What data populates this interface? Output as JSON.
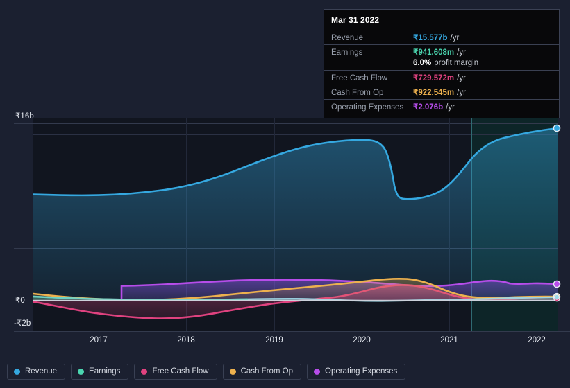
{
  "chart_data": {
    "type": "area",
    "title": "",
    "xlabel": "",
    "ylabel": "",
    "currency_symbol": "₹",
    "ylim": [
      -2,
      16
    ],
    "y_ticks": [
      {
        "label": "₹16b",
        "value": 16
      },
      {
        "label": "₹0",
        "value": 0
      },
      {
        "label": "-₹2b",
        "value": -2
      }
    ],
    "gridlines": [
      16,
      11,
      6,
      0,
      -2
    ],
    "x_ticks": [
      "2017",
      "2018",
      "2019",
      "2020",
      "2021",
      "2022"
    ],
    "x_range": [
      "2016-06",
      "2022-03"
    ],
    "grid": true,
    "legend_position": "bottom-left",
    "forecast_divider_x_label": "2021-03",
    "series": [
      {
        "name": "Revenue",
        "color": "#35a8e0",
        "unit": "b",
        "x": [
          "2016-06",
          "2016-12",
          "2017-06",
          "2017-12",
          "2018-06",
          "2018-12",
          "2019-06",
          "2019-12",
          "2020-03",
          "2020-06",
          "2020-09",
          "2020-12",
          "2021-03",
          "2021-06",
          "2021-09",
          "2021-12",
          "2022-03"
        ],
        "values": [
          9.6,
          9.5,
          9.45,
          9.6,
          10.4,
          11.6,
          12.7,
          13.2,
          13.2,
          12.6,
          9.3,
          9.25,
          10.1,
          12.7,
          13.9,
          14.3,
          15.577
        ]
      },
      {
        "name": "Earnings",
        "color": "#4bd6b0",
        "unit": "m",
        "x": [
          "2016-06",
          "2016-12",
          "2017-06",
          "2017-12",
          "2018-06",
          "2018-12",
          "2019-06",
          "2019-12",
          "2020-03",
          "2020-06",
          "2020-09",
          "2020-12",
          "2021-03",
          "2021-06",
          "2021-09",
          "2021-12",
          "2022-03"
        ],
        "values": [
          0.33,
          0.22,
          0.13,
          0.1,
          0.12,
          0.18,
          0.25,
          0.3,
          0.22,
          0.08,
          0.05,
          0.06,
          0.3,
          0.38,
          0.52,
          0.72,
          0.941608
        ]
      },
      {
        "name": "Free Cash Flow",
        "color": "#e0427f",
        "unit": "m",
        "x": [
          "2016-06",
          "2016-12",
          "2017-06",
          "2017-12",
          "2018-06",
          "2018-12",
          "2019-06",
          "2019-12",
          "2020-03",
          "2020-06",
          "2020-09",
          "2020-12",
          "2021-03",
          "2021-06",
          "2021-09",
          "2021-12",
          "2022-03"
        ],
        "values": [
          -0.15,
          -0.7,
          -1.1,
          -1.25,
          -1.0,
          -0.6,
          -0.38,
          -0.22,
          0.3,
          1.05,
          1.45,
          1.15,
          0.3,
          0.05,
          0.2,
          0.5,
          0.729572
        ]
      },
      {
        "name": "Cash From Op",
        "color": "#edb14e",
        "unit": "m",
        "x": [
          "2016-06",
          "2016-12",
          "2017-06",
          "2017-12",
          "2018-06",
          "2018-12",
          "2019-06",
          "2019-12",
          "2020-03",
          "2020-06",
          "2020-09",
          "2020-12",
          "2021-03",
          "2021-06",
          "2021-09",
          "2021-12",
          "2022-03"
        ],
        "values": [
          0.55,
          0.25,
          -0.05,
          -0.12,
          0.05,
          0.45,
          0.8,
          1.0,
          1.25,
          1.65,
          1.8,
          1.5,
          0.62,
          0.42,
          0.48,
          0.72,
          0.922545
        ]
      },
      {
        "name": "Operating Expenses",
        "color": "#b74dea",
        "unit": "b",
        "x": [
          "2017-03",
          "2017-06",
          "2017-12",
          "2018-06",
          "2018-12",
          "2019-06",
          "2019-12",
          "2020-06",
          "2020-12",
          "2021-03",
          "2021-06",
          "2021-09",
          "2021-12",
          "2022-03"
        ],
        "values": [
          1.3,
          1.32,
          1.42,
          1.55,
          1.62,
          1.65,
          1.62,
          1.42,
          1.35,
          1.62,
          1.95,
          2.05,
          1.98,
          2.076
        ]
      }
    ]
  },
  "tooltip": {
    "date": "Mar 31 2022",
    "unit_suffix": "/yr",
    "rows": [
      {
        "label": "Revenue",
        "value": "₹15.577b",
        "unit": "/yr",
        "color": "#35a8e0"
      },
      {
        "label": "Earnings",
        "value": "₹941.608m",
        "unit": "/yr",
        "color": "#4bd6b0"
      },
      {
        "label": "Free Cash Flow",
        "value": "₹729.572m",
        "unit": "/yr",
        "color": "#e0427f"
      },
      {
        "label": "Cash From Op",
        "value": "₹922.545m",
        "unit": "/yr",
        "color": "#edb14e"
      },
      {
        "label": "Operating Expenses",
        "value": "₹2.076b",
        "unit": "/yr",
        "color": "#b74dea"
      }
    ],
    "profit_margin_value": "6.0%",
    "profit_margin_label": "profit margin"
  },
  "legend": {
    "items": [
      {
        "label": "Revenue",
        "color": "#35a8e0"
      },
      {
        "label": "Earnings",
        "color": "#4bd6b0"
      },
      {
        "label": "Free Cash Flow",
        "color": "#e0427f"
      },
      {
        "label": "Cash From Op",
        "color": "#edb14e"
      },
      {
        "label": "Operating Expenses",
        "color": "#b74dea"
      }
    ]
  },
  "axis": {
    "y_labels": [
      "₹16b",
      "₹0",
      "-₹2b"
    ],
    "x_labels": [
      "2017",
      "2018",
      "2019",
      "2020",
      "2021",
      "2022"
    ]
  },
  "colors": {
    "background": "#1b2030",
    "plot_background": "#11151f",
    "gridline": "#2e3547",
    "zero_line": "#c9ced8",
    "highlight_band": "#0e2b2e",
    "divider": "#2f6a72"
  }
}
